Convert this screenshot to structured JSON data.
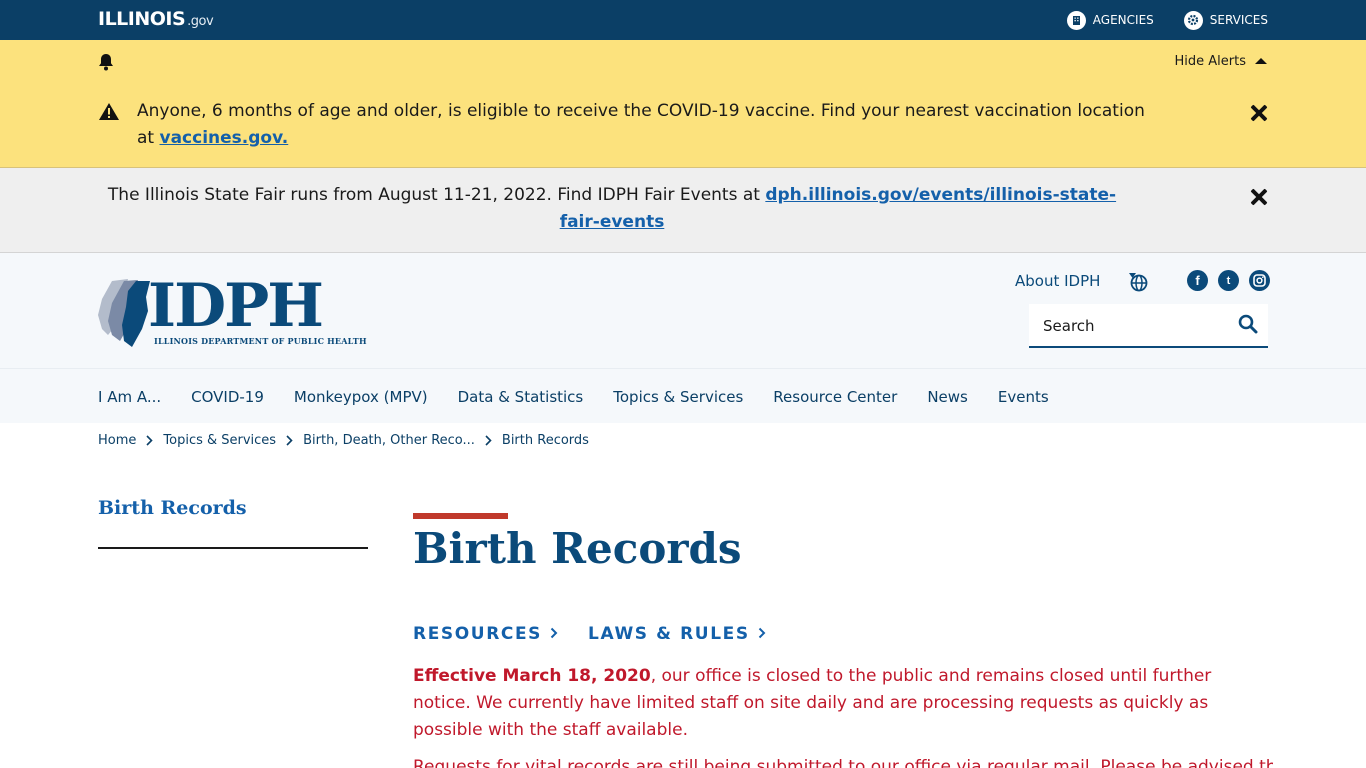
{
  "topbar": {
    "logo_main": "ILLINOIS",
    "logo_suffix": ".gov",
    "agencies_label": "AGENCIES",
    "services_label": "SERVICES"
  },
  "alerts": {
    "hide_label": "Hide Alerts",
    "covid": {
      "text": "Anyone, 6 months of age and older, is eligible to receive the COVID-19 vaccine. Find your nearest vaccination location at ",
      "link_text": "vaccines.gov."
    },
    "fair": {
      "text": "The Illinois State Fair runs from August 11-21, 2022. Find IDPH Fair Events at ",
      "link_text": "dph.illinois.gov/events/illinois-state-fair-events"
    }
  },
  "header": {
    "logo_word": "IDPH",
    "logo_sub": "ILLINOIS DEPARTMENT OF PUBLIC HEALTH",
    "about_label": "About IDPH",
    "search_placeholder": "Search",
    "social": [
      "f",
      "t",
      "ig"
    ]
  },
  "nav": {
    "items": [
      "I Am A...",
      "COVID-19",
      "Monkeypox (MPV)",
      "Data & Statistics",
      "Topics & Services",
      "Resource Center",
      "News",
      "Events"
    ]
  },
  "breadcrumb": [
    "Home",
    "Topics & Services",
    "Birth, Death, Other Reco...",
    "Birth Records"
  ],
  "sidebar": {
    "title": "Birth Records"
  },
  "content": {
    "title": "Birth Records",
    "tabs": [
      "RESOURCES",
      "LAWS & RULES"
    ],
    "notice_bold": "Effective March 18, 2020",
    "notice_rest": ", our office is closed to the public and remains closed until further notice. We currently have limited staff on site daily and are processing requests as quickly as possible with the staff available.",
    "notice2": "Requests for vital records are still being submitted to our office via regular mail. Please be advised that"
  },
  "colors": {
    "topbar": "#0b3f66",
    "alert": "#fce27d",
    "brand": "#0b4a7a",
    "link": "#1460aa",
    "accent": "#c0392b",
    "notice": "#c0182b"
  }
}
